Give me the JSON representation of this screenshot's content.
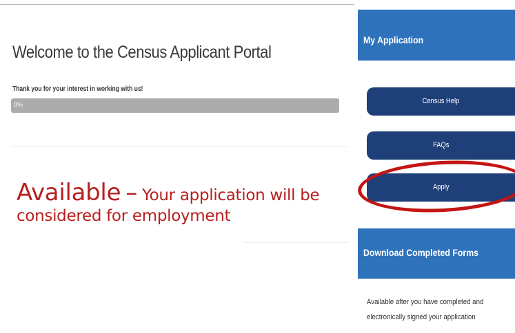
{
  "main": {
    "title": "Welcome to the Census Applicant Portal",
    "subtitle": "Thank you for your interest in working with us!",
    "progress": {
      "label": "0%",
      "percent": 0,
      "fill_color": "#2f6db0",
      "track_color": "#acacac"
    }
  },
  "annotation": {
    "status_word": "Available",
    "dash": "–",
    "status_detail": "Your application will be considered for employment",
    "color": "#b81f1f"
  },
  "sidebar": {
    "application_header": "My Application",
    "buttons": [
      {
        "label": "Census Help"
      },
      {
        "label": "FAQs"
      },
      {
        "label": "Apply"
      }
    ],
    "download_header": "Download Completed Forms",
    "download_note": "Available after you have completed and electronically signed your application",
    "header_color": "#2f72bc",
    "button_color": "#1f3f78",
    "highlight_color": "#c41414"
  }
}
